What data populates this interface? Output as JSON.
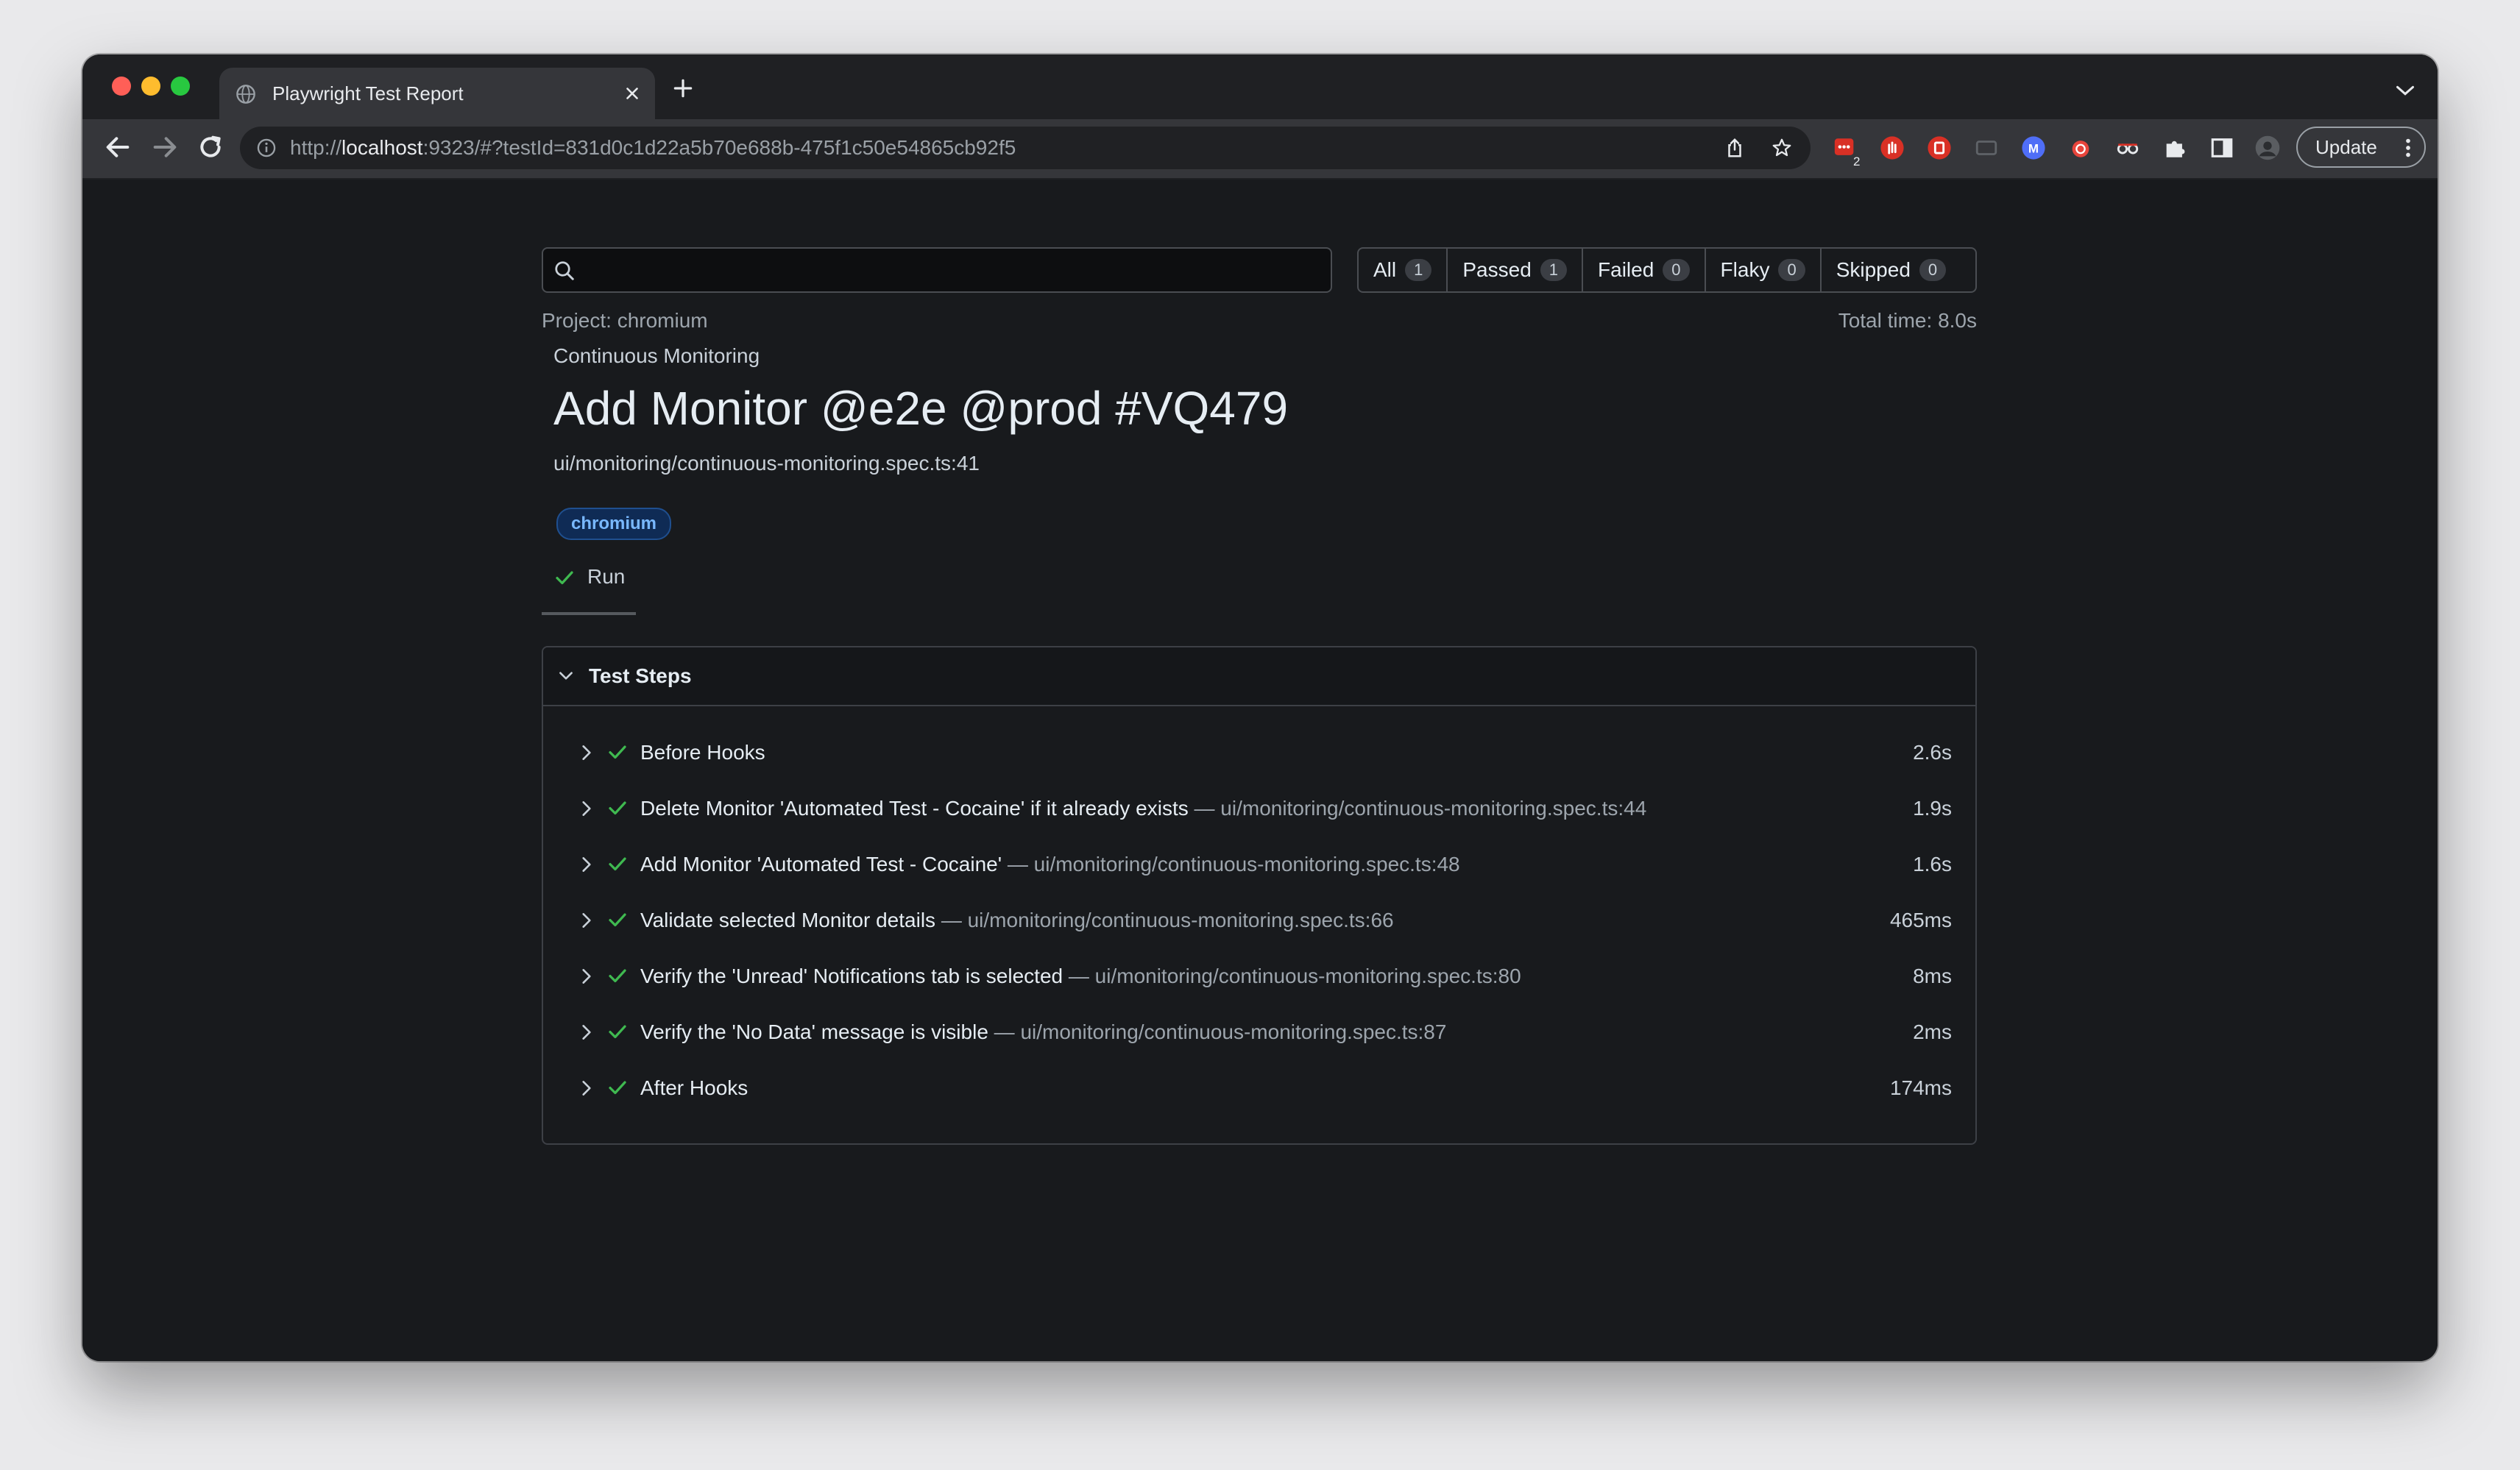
{
  "browser": {
    "tab_title": "Playwright Test Report",
    "url_prefix": "http://",
    "url_host": "localhost",
    "url_rest": ":9323/#?testId=831d0c1d22a5b70e688b-475f1c50e54865cb92f5",
    "update_label": "Update",
    "extension_badge": "2",
    "extension_icons": [
      "todoist-icon",
      "hand-icon",
      "record-icon",
      "monitor-icon",
      "m-icon",
      "bug-icon",
      "glasses-icon",
      "puzzle-icon"
    ]
  },
  "report": {
    "search_placeholder": "",
    "filters": [
      {
        "label": "All",
        "count": "1"
      },
      {
        "label": "Passed",
        "count": "1"
      },
      {
        "label": "Failed",
        "count": "0"
      },
      {
        "label": "Flaky",
        "count": "0"
      },
      {
        "label": "Skipped",
        "count": "0"
      }
    ],
    "project": "Project: chromium",
    "total_time": "Total time: 8.0s",
    "suite": "Continuous Monitoring",
    "test_title": "Add Monitor @e2e @prod #VQ479",
    "location": "ui/monitoring/continuous-monitoring.spec.ts:41",
    "badge": "chromium",
    "run_tab": "Run",
    "steps_title": "Test Steps",
    "steps": [
      {
        "label": "Before Hooks",
        "location": "",
        "duration": "2.6s"
      },
      {
        "label": "Delete Monitor 'Automated Test - Cocaine' if it already exists",
        "location": " — ui/monitoring/continuous-monitoring.spec.ts:44",
        "duration": "1.9s"
      },
      {
        "label": "Add Monitor 'Automated Test - Cocaine'",
        "location": " — ui/monitoring/continuous-monitoring.spec.ts:48",
        "duration": "1.6s"
      },
      {
        "label": "Validate selected Monitor details",
        "location": " — ui/monitoring/continuous-monitoring.spec.ts:66",
        "duration": "465ms"
      },
      {
        "label": "Verify the 'Unread' Notifications tab is selected",
        "location": " — ui/monitoring/continuous-monitoring.spec.ts:80",
        "duration": "8ms"
      },
      {
        "label": "Verify the 'No Data' message is visible",
        "location": " — ui/monitoring/continuous-monitoring.spec.ts:87",
        "duration": "2ms"
      },
      {
        "label": "After Hooks",
        "location": "",
        "duration": "174ms"
      }
    ]
  },
  "colors": {
    "page_bg": "#181a1d",
    "pass_green": "#3fb950",
    "badge_bg": "#0f2b55",
    "badge_text": "#79b8ff"
  }
}
